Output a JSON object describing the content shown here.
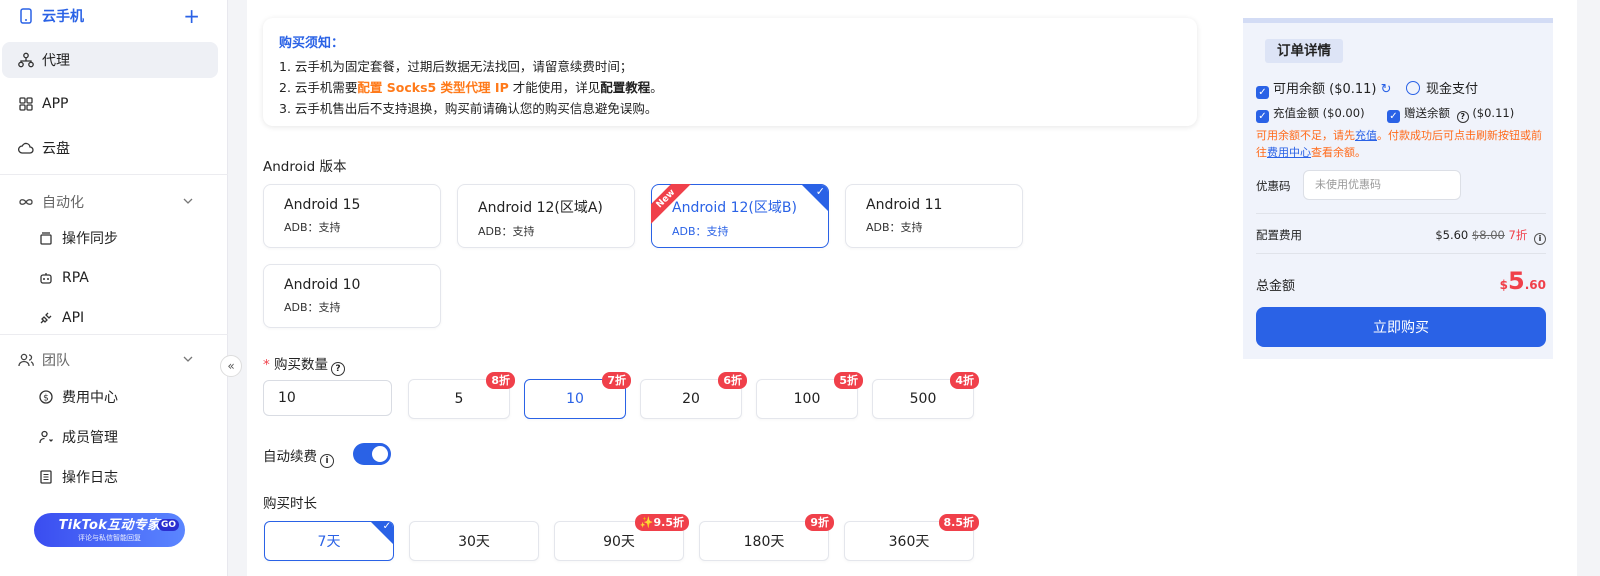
{
  "sidebar": {
    "cloud_phone": "云手机",
    "proxy": "代理",
    "app": "APP",
    "cloud_disk": "云盘",
    "automation": "自动化",
    "op_sync": "操作同步",
    "rpa": "RPA",
    "api": "API",
    "team": "团队",
    "billing": "费用中心",
    "members": "成员管理",
    "op_log": "操作日志",
    "promo_title": "TikTok互动专家",
    "promo_go": "GO",
    "promo_sub": "评论与私信智能回复"
  },
  "notice": {
    "title": "购买须知：",
    "line1": "1. 云手机为固定套餐，过期后数据无法找回，请留意续费时间；",
    "line2_a": "2. 云手机需要",
    "line2_b": "配置 Socks5 类型代理 IP",
    "line2_c": " 才能使用，详见",
    "line2_d": "配置教程",
    "line2_e": "。",
    "line3": "3. 云手机售出后不支持退换，购买前请确认您的购买信息避免误购。"
  },
  "android": {
    "label": "Android 版本",
    "new_tag": "New",
    "versions": [
      {
        "name": "Android 15",
        "adb": "ADB：支持"
      },
      {
        "name": "Android 12(区域A)",
        "adb": "ADB：支持"
      },
      {
        "name": "Android 12(区域B)",
        "adb": "ADB：支持"
      },
      {
        "name": "Android 11",
        "adb": "ADB：支持"
      },
      {
        "name": "Android 10",
        "adb": "ADB：支持"
      }
    ],
    "selected": "Android 12(区域B)"
  },
  "quantity": {
    "required_mark": "*",
    "label": "购买数量",
    "input_value": "10",
    "options": [
      {
        "value": "5",
        "discount": "8折"
      },
      {
        "value": "10",
        "discount": "7折"
      },
      {
        "value": "20",
        "discount": "6折"
      },
      {
        "value": "100",
        "discount": "5折"
      },
      {
        "value": "500",
        "discount": "4折"
      }
    ],
    "selected": "10"
  },
  "auto_renew": {
    "label": "自动续费",
    "enabled": true
  },
  "duration": {
    "label": "购买时长",
    "options": [
      {
        "value": "7天",
        "discount": ""
      },
      {
        "value": "30天",
        "discount": ""
      },
      {
        "value": "90天",
        "discount": "✨9.5折"
      },
      {
        "value": "180天",
        "discount": "9折"
      },
      {
        "value": "360天",
        "discount": "8.5折"
      }
    ],
    "selected": "7天"
  },
  "order": {
    "title": "订单详情",
    "balance": "可用余额 ($0.11)",
    "cash": "现金支付",
    "recharge_amount": "充值金额 ($0.00)",
    "gift_amount": "赠送余额",
    "gift_value": "($0.11)",
    "warn_a": "可用余额不足，请先",
    "warn_link1": "充值",
    "warn_b": "。付款成功后可点击刷新按钮或前往",
    "warn_link2": "费用中心",
    "warn_c": "查看余额。",
    "coupon_label": "优惠码",
    "coupon_placeholder": "未使用优惠码",
    "config_fee_label": "配置费用",
    "config_fee": "$5.60",
    "config_fee_orig": "$8.00",
    "config_fee_discount": "7折",
    "total_label": "总金额",
    "total_currency": "$",
    "total_int": "5",
    "total_dec": ".60",
    "buy_button": "立即购买"
  },
  "colors": {
    "accent": "#2a62e6",
    "badge": "#f0404a",
    "orange": "#ff7a1a"
  }
}
